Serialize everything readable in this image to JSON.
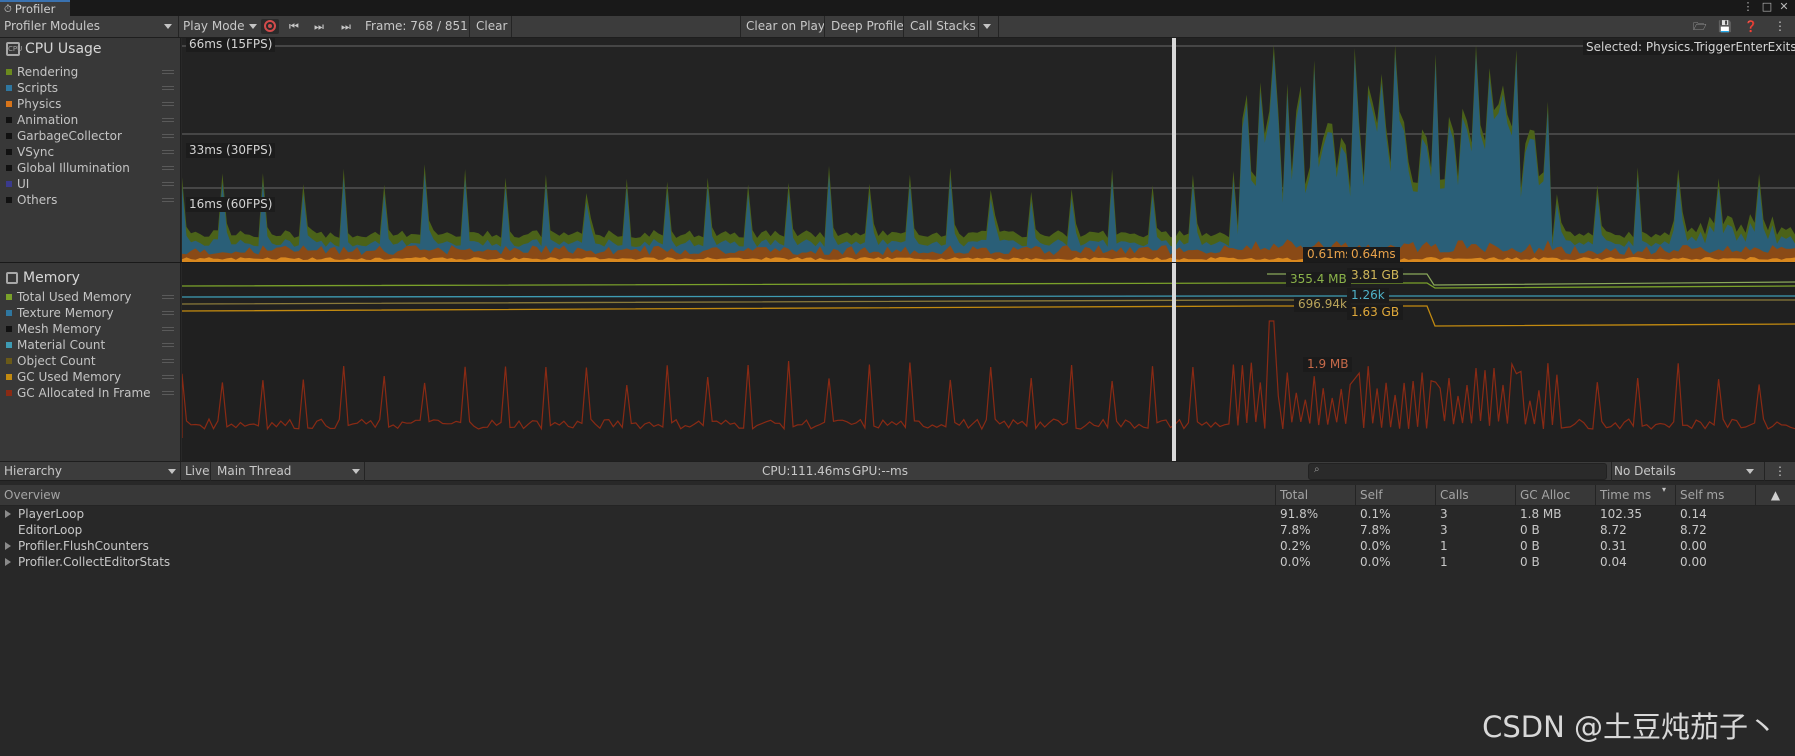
{
  "window": {
    "title": "Profiler"
  },
  "toolbar": {
    "modules_label": "Profiler Modules",
    "play_mode_label": "Play Mode",
    "frame_label": "Frame: 768 / 851",
    "clear_label": "Clear",
    "clear_on_play_label": "Clear on Play",
    "deep_profile_label": "Deep Profile",
    "call_stacks_label": "Call Stacks"
  },
  "cpu_module": {
    "title": "CPU Usage",
    "legend": [
      {
        "name": "Rendering",
        "color": "#6b8a1e"
      },
      {
        "name": "Scripts",
        "color": "#2f77a0"
      },
      {
        "name": "Physics",
        "color": "#d7741a"
      },
      {
        "name": "Animation",
        "color": "#111111"
      },
      {
        "name": "GarbageCollector",
        "color": "#111111"
      },
      {
        "name": "VSync",
        "color": "#111111"
      },
      {
        "name": "Global Illumination",
        "color": "#111111"
      },
      {
        "name": "UI",
        "color": "#3a3a8c"
      },
      {
        "name": "Others",
        "color": "#111111"
      }
    ],
    "markers": [
      "66ms (15FPS)",
      "33ms (30FPS)",
      "16ms (60FPS)"
    ],
    "selected": "Selected: Physics.TriggerEnterExits",
    "value_left": "0.61ms",
    "value_right": "0.64ms"
  },
  "memory_module": {
    "title": "Memory",
    "legend": [
      {
        "name": "Total Used Memory",
        "color": "#7aa12a"
      },
      {
        "name": "Texture Memory",
        "color": "#2f77a0"
      },
      {
        "name": "Mesh Memory",
        "color": "#111111"
      },
      {
        "name": "Material Count",
        "color": "#3e9bb3"
      },
      {
        "name": "Object Count",
        "color": "#6a5a18"
      },
      {
        "name": "GC Used Memory",
        "color": "#c28a10"
      },
      {
        "name": "GC Allocated In Frame",
        "color": "#8a2a14"
      }
    ],
    "values": {
      "total_left": "355.4 MB",
      "total_right": "3.81 GB",
      "material_right": "1.26k",
      "object_left": "696.94k",
      "gc_used_right": "1.63 GB",
      "gc_alloc": "1.9 MB"
    }
  },
  "hierarchy_bar": {
    "view_label": "Hierarchy",
    "live_label": "Live",
    "thread_label": "Main Thread",
    "cpu_label": "CPU:111.46ms",
    "gpu_label": "GPU:--ms",
    "details_label": "No Details"
  },
  "table": {
    "columns": [
      "Overview",
      "Total",
      "Self",
      "Calls",
      "GC Alloc",
      "Time ms",
      "Self ms"
    ],
    "rows": [
      {
        "name": "PlayerLoop",
        "expandable": true,
        "total": "91.8%",
        "self": "0.1%",
        "calls": "3",
        "gc_alloc": "1.8 MB",
        "time_ms": "102.35",
        "self_ms": "0.14"
      },
      {
        "name": "EditorLoop",
        "expandable": false,
        "total": "7.8%",
        "self": "7.8%",
        "calls": "3",
        "gc_alloc": "0 B",
        "time_ms": "8.72",
        "self_ms": "8.72"
      },
      {
        "name": "Profiler.FlushCounters",
        "expandable": true,
        "total": "0.2%",
        "self": "0.0%",
        "calls": "1",
        "gc_alloc": "0 B",
        "time_ms": "0.31",
        "self_ms": "0.00"
      },
      {
        "name": "Profiler.CollectEditorStats",
        "expandable": true,
        "total": "0.0%",
        "self": "0.0%",
        "calls": "1",
        "gc_alloc": "0 B",
        "time_ms": "0.04",
        "self_ms": "0.00"
      }
    ]
  },
  "watermark": "CSDN @土豆炖茄子丶"
}
